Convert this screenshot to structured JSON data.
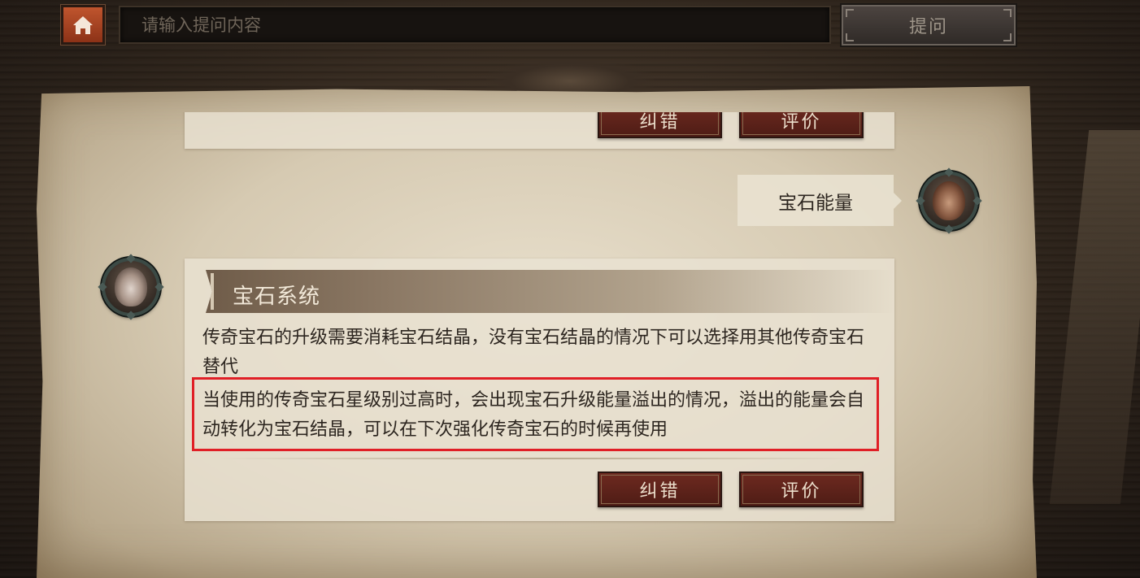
{
  "header": {
    "home_icon": "home-icon",
    "search_placeholder": "请输入提问内容",
    "ask_label": "提问"
  },
  "previous_answer": {
    "correct_label": "纠错",
    "rate_label": "评价"
  },
  "user_message": {
    "text": "宝石能量"
  },
  "bot_answer": {
    "title": "宝石系统",
    "paragraph_1": "传奇宝石的升级需要消耗宝石结晶，没有宝石结晶的情况下可以选择用其他传奇宝石替代",
    "paragraph_2": "当使用的传奇宝石星级别过高时，会出现宝石升级能量溢出的情况，溢出的能量会自动转化为宝石结晶，可以在下次强化传奇宝石的时候再使用",
    "highlight_color": "#e01f26",
    "correct_label": "纠错",
    "rate_label": "评价"
  },
  "colors": {
    "home_button": "#b04a26",
    "action_button": "#5e231a",
    "parchment": "#d9cdb5"
  }
}
